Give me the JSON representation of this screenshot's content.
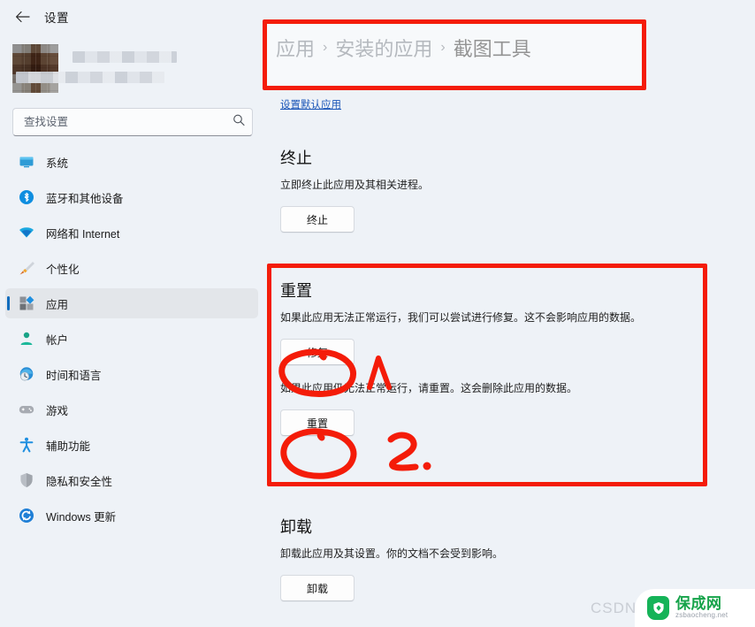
{
  "window": {
    "title": "设置",
    "back_icon": "back-arrow-icon"
  },
  "sidebar": {
    "profile": {
      "censored": true,
      "avatar_icon": "blurred-avatar"
    },
    "search": {
      "placeholder": "查找设置",
      "value": "",
      "icon": "search-icon"
    },
    "items": [
      {
        "label": "系统",
        "icon": "monitor-icon",
        "selected": false
      },
      {
        "label": "蓝牙和其他设备",
        "icon": "bluetooth-icon",
        "selected": false
      },
      {
        "label": "网络和 Internet",
        "icon": "wifi-icon",
        "selected": false
      },
      {
        "label": "个性化",
        "icon": "paintbrush-icon",
        "selected": false
      },
      {
        "label": "应用",
        "icon": "apps-icon",
        "selected": true
      },
      {
        "label": "帐户",
        "icon": "person-icon",
        "selected": false
      },
      {
        "label": "时间和语言",
        "icon": "clock-globe-icon",
        "selected": false
      },
      {
        "label": "游戏",
        "icon": "gamepad-icon",
        "selected": false
      },
      {
        "label": "辅助功能",
        "icon": "accessibility-icon",
        "selected": false
      },
      {
        "label": "隐私和安全性",
        "icon": "shield-icon",
        "selected": false
      },
      {
        "label": "Windows 更新",
        "icon": "update-refresh-icon",
        "selected": false
      }
    ]
  },
  "main": {
    "breadcrumb": {
      "root": "应用",
      "parent": "安装的应用",
      "current": "截图工具",
      "separator": "›"
    },
    "default_apps_link": "设置默认应用",
    "sections": [
      {
        "id": "terminate",
        "title": "终止",
        "description": "立即终止此应用及其相关进程。",
        "button": "终止"
      },
      {
        "id": "reset",
        "title": "重置",
        "description": "如果此应用无法正常运行，我们可以尝试进行修复。这不会影响应用的数据。",
        "button": "修复",
        "description2": "如果此应用仍无法正常运行，请重置。这会删除此应用的数据。",
        "button2": "重置"
      },
      {
        "id": "uninstall",
        "title": "卸载",
        "description": "卸载此应用及其设置。你的文档不会受到影响。",
        "button": "卸载"
      }
    ]
  },
  "annotations": {
    "color": "#f41c09",
    "step_one": "1.",
    "step_two": "2.",
    "boxes": [
      "breadcrumb-highlight-box",
      "reset-section-highlight-box"
    ],
    "circles": [
      "repair-button-circle",
      "reset-button-circle"
    ]
  },
  "watermarks": {
    "csdn": "CSDN",
    "brand_name": "保成网",
    "brand_url": "zsbaocheng.net",
    "brand_color": "#16a34a"
  }
}
